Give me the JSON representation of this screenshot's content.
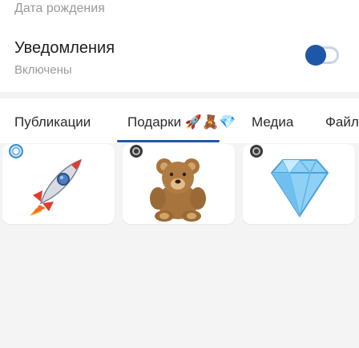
{
  "profile": {
    "dob_label": "Дата рождения"
  },
  "notifications": {
    "title": "Уведомления",
    "subtitle": "Включены",
    "toggle_on": true,
    "accent": "#1f57a8"
  },
  "tabs": [
    {
      "label": "Публикации",
      "active": false
    },
    {
      "label": "Подарки 🚀🧸💎",
      "active": true
    },
    {
      "label": "Медиа",
      "active": false
    },
    {
      "label": "Файлы",
      "active": false
    }
  ],
  "gifts": [
    {
      "name": "rocket",
      "icon": "rocket-icon",
      "badge": "blue-ring-badge"
    },
    {
      "name": "teddy-bear",
      "icon": "teddy-bear-icon",
      "badge": "dark-dot-badge"
    },
    {
      "name": "gem",
      "icon": "gem-icon",
      "badge": "dark-dot-badge"
    }
  ]
}
